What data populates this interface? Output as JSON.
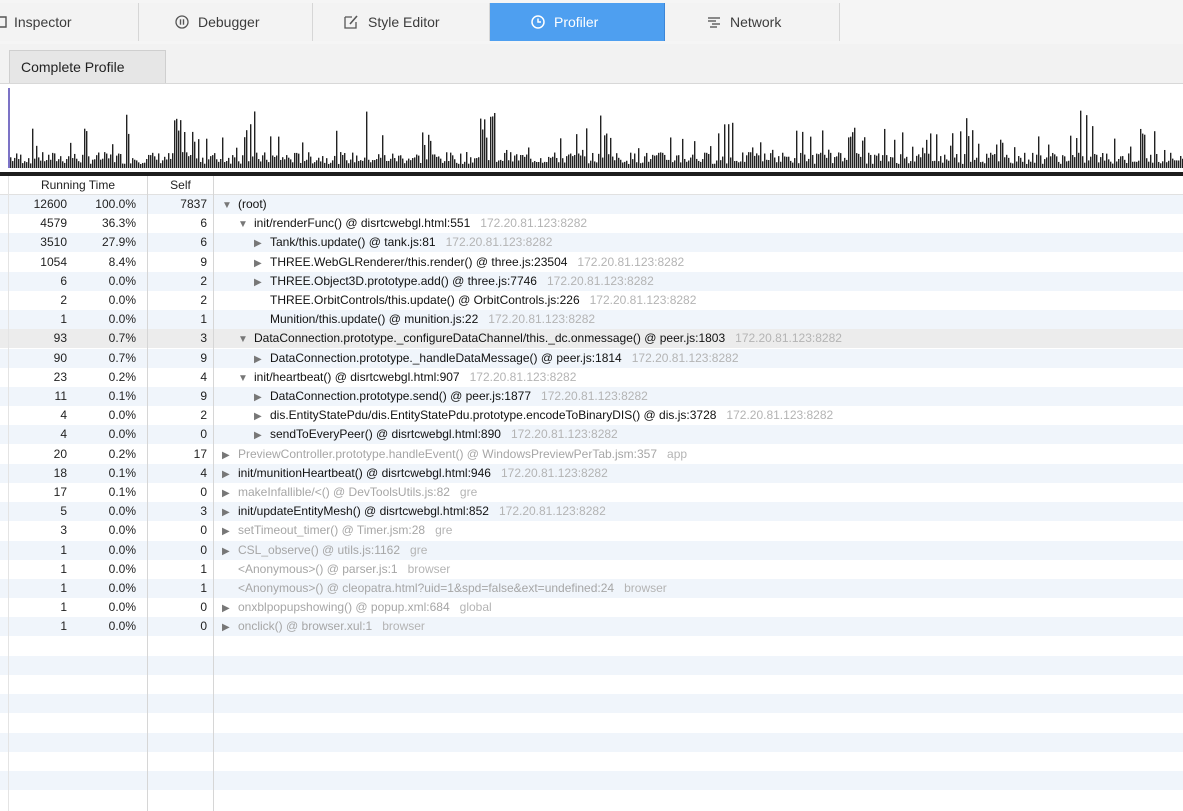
{
  "toolbar": {
    "tabs": [
      {
        "label": "Inspector",
        "icon": "inspector-icon",
        "selected": false
      },
      {
        "label": "Debugger",
        "icon": "debugger-icon",
        "selected": false
      },
      {
        "label": "Style Editor",
        "icon": "style-editor-icon",
        "selected": false
      },
      {
        "label": "Profiler",
        "icon": "profiler-icon",
        "selected": true
      },
      {
        "label": "Network",
        "icon": "network-icon",
        "selected": false
      }
    ]
  },
  "subtabs": {
    "complete_profile": "Complete Profile"
  },
  "tree": {
    "headers": {
      "running_time": "Running Time",
      "self": "Self"
    },
    "rows": [
      {
        "total": "12600",
        "pct": "100.0%",
        "self": "7837",
        "twisty": "▼",
        "fn": "(root)",
        "host": "",
        "dim": false
      },
      {
        "total": "4579",
        "pct": "36.3%",
        "self": "6",
        "twisty": "▼",
        "fn": "init/renderFunc() @ disrtcwebgl.html:551",
        "host": "172.20.81.123:8282",
        "dim": false
      },
      {
        "total": "3510",
        "pct": "27.9%",
        "self": "6",
        "twisty": "▶",
        "fn": "Tank/this.update() @ tank.js:81",
        "host": "172.20.81.123:8282",
        "dim": false
      },
      {
        "total": "1054",
        "pct": "8.4%",
        "self": "9",
        "twisty": "▶",
        "fn": "THREE.WebGLRenderer/this.render() @ three.js:23504",
        "host": "172.20.81.123:8282",
        "dim": false
      },
      {
        "total": "6",
        "pct": "0.0%",
        "self": "2",
        "twisty": "▶",
        "fn": "THREE.Object3D.prototype.add() @ three.js:7746",
        "host": "172.20.81.123:8282",
        "dim": false
      },
      {
        "total": "2",
        "pct": "0.0%",
        "self": "2",
        "twisty": "",
        "fn": "THREE.OrbitControls/this.update() @ OrbitControls.js:226",
        "host": "172.20.81.123:8282",
        "dim": false
      },
      {
        "total": "1",
        "pct": "0.0%",
        "self": "1",
        "twisty": "",
        "fn": "Munition/this.update() @ munition.js:22",
        "host": "172.20.81.123:8282",
        "dim": false
      },
      {
        "total": "93",
        "pct": "0.7%",
        "self": "3",
        "twisty": "▼",
        "fn": "DataConnection.prototype._configureDataChannel/this._dc.onmessage() @ peer.js:1803",
        "host": "172.20.81.123:8282",
        "dim": false
      },
      {
        "total": "90",
        "pct": "0.7%",
        "self": "9",
        "twisty": "▶",
        "fn": "DataConnection.prototype._handleDataMessage() @ peer.js:1814",
        "host": "172.20.81.123:8282",
        "dim": false
      },
      {
        "total": "23",
        "pct": "0.2%",
        "self": "4",
        "twisty": "▼",
        "fn": "init/heartbeat() @ disrtcwebgl.html:907",
        "host": "172.20.81.123:8282",
        "dim": false
      },
      {
        "total": "11",
        "pct": "0.1%",
        "self": "9",
        "twisty": "▶",
        "fn": "DataConnection.prototype.send() @ peer.js:1877",
        "host": "172.20.81.123:8282",
        "dim": false
      },
      {
        "total": "4",
        "pct": "0.0%",
        "self": "2",
        "twisty": "▶",
        "fn": "dis.EntityStatePdu/dis.EntityStatePdu.prototype.encodeToBinaryDIS() @ dis.js:3728",
        "host": "172.20.81.123:8282",
        "dim": false
      },
      {
        "total": "4",
        "pct": "0.0%",
        "self": "0",
        "twisty": "▶",
        "fn": "sendToEveryPeer() @ disrtcwebgl.html:890",
        "host": "172.20.81.123:8282",
        "dim": false
      },
      {
        "total": "20",
        "pct": "0.2%",
        "self": "17",
        "twisty": "▶",
        "fn": "PreviewController.prototype.handleEvent() @ WindowsPreviewPerTab.jsm:357",
        "host": "app",
        "dim": true
      },
      {
        "total": "18",
        "pct": "0.1%",
        "self": "4",
        "twisty": "▶",
        "fn": "init/munitionHeartbeat() @ disrtcwebgl.html:946",
        "host": "172.20.81.123:8282",
        "dim": false
      },
      {
        "total": "17",
        "pct": "0.1%",
        "self": "0",
        "twisty": "▶",
        "fn": "makeInfallible/<() @ DevToolsUtils.js:82",
        "host": "gre",
        "dim": true
      },
      {
        "total": "5",
        "pct": "0.0%",
        "self": "3",
        "twisty": "▶",
        "fn": "init/updateEntityMesh() @ disrtcwebgl.html:852",
        "host": "172.20.81.123:8282",
        "dim": false
      },
      {
        "total": "3",
        "pct": "0.0%",
        "self": "0",
        "twisty": "▶",
        "fn": "setTimeout_timer() @ Timer.jsm:28",
        "host": "gre",
        "dim": true
      },
      {
        "total": "1",
        "pct": "0.0%",
        "self": "0",
        "twisty": "▶",
        "fn": "CSL_observe() @ utils.js:1162",
        "host": "gre",
        "dim": true
      },
      {
        "total": "1",
        "pct": "0.0%",
        "self": "1",
        "twisty": "",
        "fn": "<Anonymous>() @ parser.js:1",
        "host": "browser",
        "dim": true
      },
      {
        "total": "1",
        "pct": "0.0%",
        "self": "1",
        "twisty": "",
        "fn": "<Anonymous>() @ cleopatra.html?uid=1&spd=false&ext=undefined:24",
        "host": "browser",
        "dim": true
      },
      {
        "total": "1",
        "pct": "0.0%",
        "self": "0",
        "twisty": "▶",
        "fn": "onxblpopupshowing() @ popup.xml:684",
        "host": "global",
        "dim": true
      },
      {
        "total": "1",
        "pct": "0.0%",
        "self": "0",
        "twisty": "▶",
        "fn": "onclick() @ browser.xul:1",
        "host": "browser",
        "dim": true
      }
    ]
  }
}
